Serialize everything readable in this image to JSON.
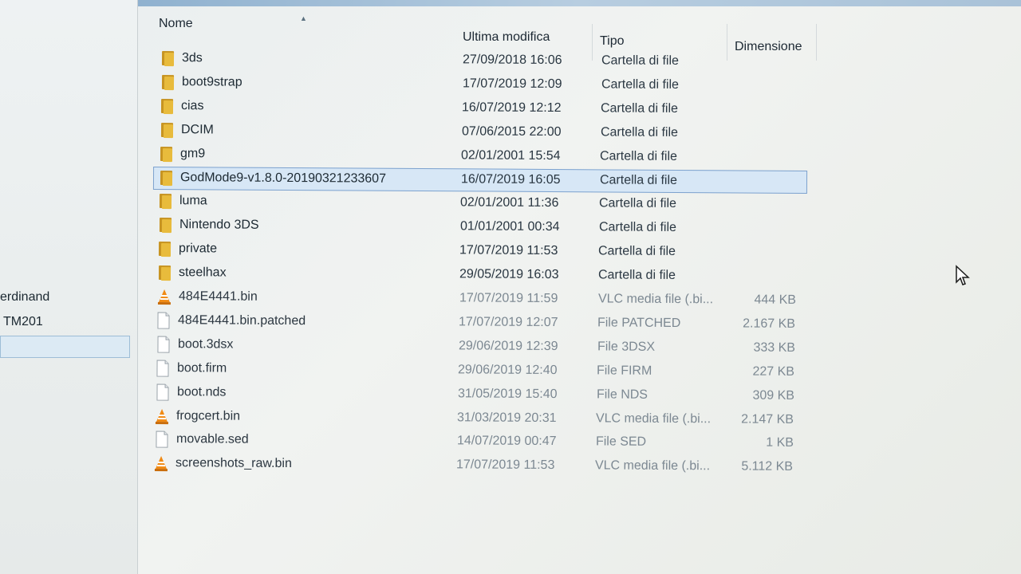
{
  "columns": {
    "name": "Nome",
    "date": "Ultima modifica",
    "type": "Tipo",
    "size": "Dimensione"
  },
  "sidebar": {
    "items": [
      "erdinand",
      "TM201"
    ]
  },
  "files": [
    {
      "name": "3ds",
      "date": "27/09/2018 16:06",
      "type": "Cartella di file",
      "size": "",
      "icon": "folder-icon"
    },
    {
      "name": "boot9strap",
      "date": "17/07/2019 12:09",
      "type": "Cartella di file",
      "size": "",
      "icon": "folder-icon"
    },
    {
      "name": "cias",
      "date": "16/07/2019 12:12",
      "type": "Cartella di file",
      "size": "",
      "icon": "folder-icon"
    },
    {
      "name": "DCIM",
      "date": "07/06/2015 22:00",
      "type": "Cartella di file",
      "size": "",
      "icon": "folder-icon"
    },
    {
      "name": "gm9",
      "date": "02/01/2001 15:54",
      "type": "Cartella di file",
      "size": "",
      "icon": "folder-icon"
    },
    {
      "name": "GodMode9-v1.8.0-20190321233607",
      "date": "16/07/2019 16:05",
      "type": "Cartella di file",
      "size": "",
      "icon": "folder-icon",
      "selected": true
    },
    {
      "name": "luma",
      "date": "02/01/2001 11:36",
      "type": "Cartella di file",
      "size": "",
      "icon": "folder-icon"
    },
    {
      "name": "Nintendo 3DS",
      "date": "01/01/2001 00:34",
      "type": "Cartella di file",
      "size": "",
      "icon": "folder-icon"
    },
    {
      "name": "private",
      "date": "17/07/2019 11:53",
      "type": "Cartella di file",
      "size": "",
      "icon": "folder-icon"
    },
    {
      "name": "steelhax",
      "date": "29/05/2019 16:03",
      "type": "Cartella di file",
      "size": "",
      "icon": "folder-icon"
    },
    {
      "name": "484E4441.bin",
      "date": "17/07/2019 11:59",
      "type": "VLC media file (.bi...",
      "size": "444 KB",
      "icon": "vlc-icon"
    },
    {
      "name": "484E4441.bin.patched",
      "date": "17/07/2019 12:07",
      "type": "File PATCHED",
      "size": "2.167 KB",
      "icon": "file-icon"
    },
    {
      "name": "boot.3dsx",
      "date": "29/06/2019 12:39",
      "type": "File 3DSX",
      "size": "333 KB",
      "icon": "file-icon"
    },
    {
      "name": "boot.firm",
      "date": "29/06/2019 12:40",
      "type": "File FIRM",
      "size": "227 KB",
      "icon": "file-icon"
    },
    {
      "name": "boot.nds",
      "date": "31/05/2019 15:40",
      "type": "File NDS",
      "size": "309 KB",
      "icon": "file-icon"
    },
    {
      "name": "frogcert.bin",
      "date": "31/03/2019 20:31",
      "type": "VLC media file (.bi...",
      "size": "2.147 KB",
      "icon": "vlc-icon"
    },
    {
      "name": "movable.sed",
      "date": "14/07/2019 00:47",
      "type": "File SED",
      "size": "1 KB",
      "icon": "file-icon"
    },
    {
      "name": "screenshots_raw.bin",
      "date": "17/07/2019 11:53",
      "type": "VLC media file (.bi...",
      "size": "5.112 KB",
      "icon": "vlc-icon"
    }
  ]
}
